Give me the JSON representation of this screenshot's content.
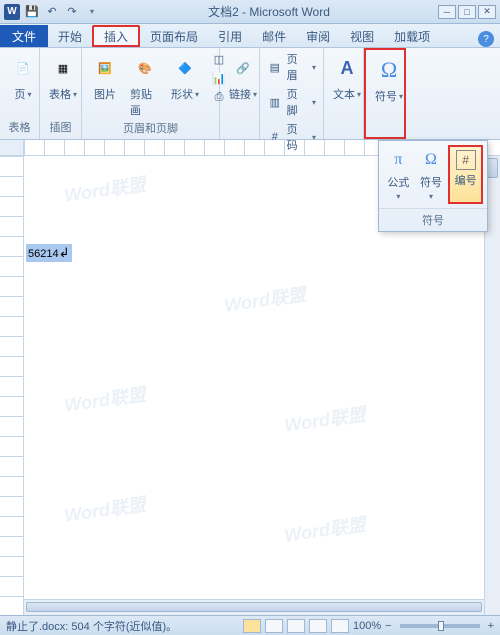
{
  "title": "文档2 - Microsoft Word",
  "app_icon": "W",
  "tabs": {
    "file": "文件",
    "home": "开始",
    "insert": "插入",
    "layout": "页面布局",
    "ref": "引用",
    "mail": "邮件",
    "review": "审阅",
    "view": "视图",
    "addin": "加载项"
  },
  "ribbon": {
    "pages": {
      "page": "页",
      "label": "表格"
    },
    "tables": {
      "table": "表格"
    },
    "illust": {
      "pic": "图片",
      "clip": "剪贴画",
      "shapes": "形状",
      "label": "插图"
    },
    "links": {
      "link": "链接"
    },
    "header": {
      "header": "页眉",
      "footer": "页脚",
      "pgnum": "页码",
      "label": "页眉和页脚"
    },
    "text": {
      "text": "文本"
    },
    "symbols": {
      "symbol": "符号"
    }
  },
  "dropdown": {
    "eq": "公式",
    "sym": "符号",
    "num": "编号",
    "footer": "符号"
  },
  "doc_text": "56214",
  "watermark": "Word联盟",
  "status": {
    "left": "静止了.docx: 504 个字符(近似值)。",
    "zoom": "100%"
  }
}
